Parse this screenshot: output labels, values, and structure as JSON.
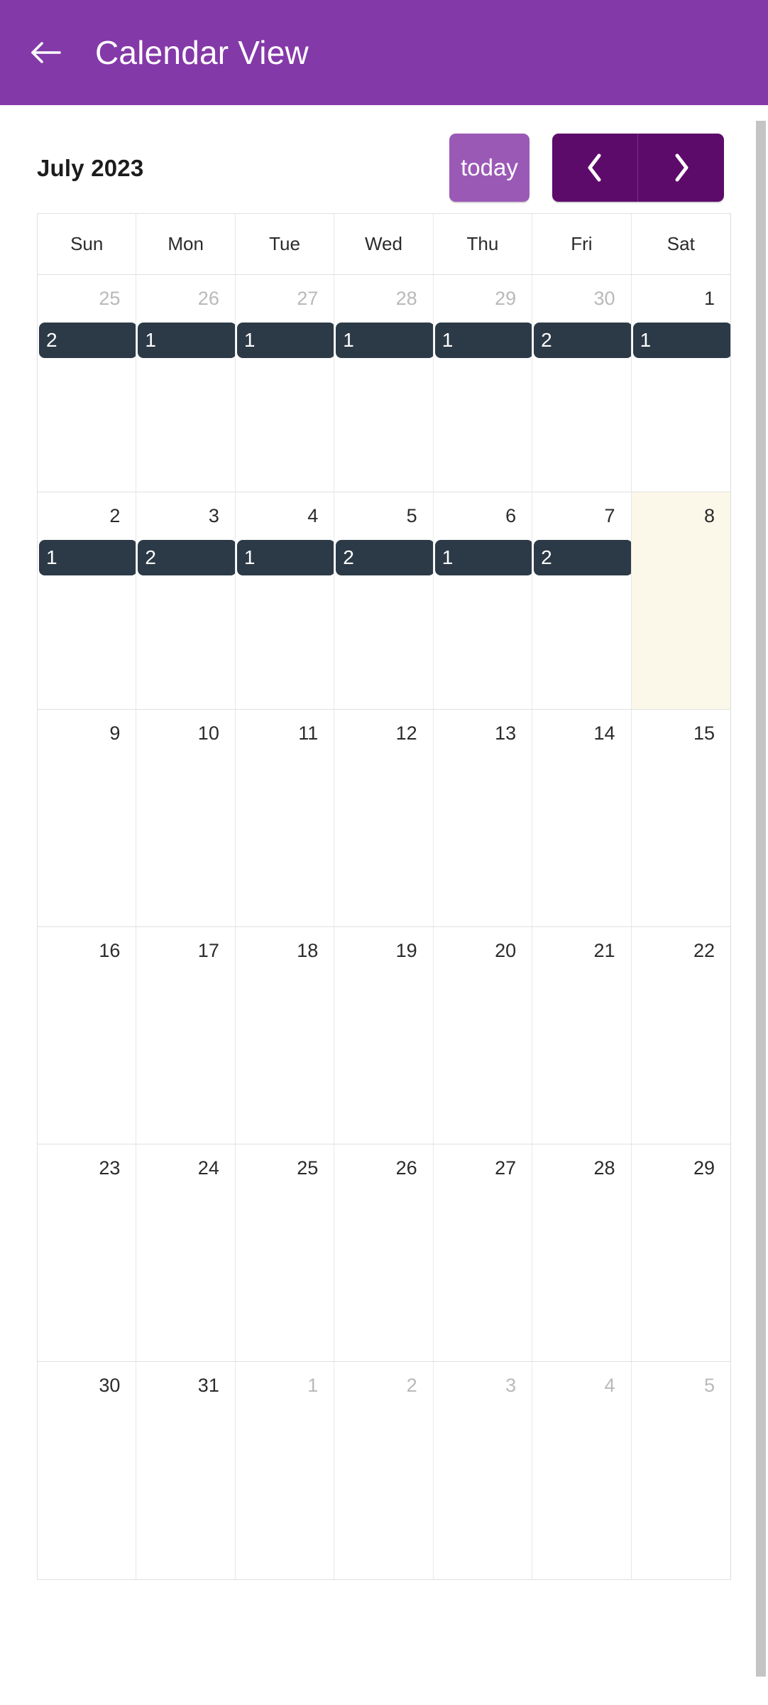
{
  "appbar": {
    "back_icon": "arrow-left-icon",
    "title": "Calendar View",
    "bg_color": "#8439a8"
  },
  "toolbar": {
    "title": "July 2023",
    "today_label": "today",
    "prev_icon": "chevron-left-icon",
    "next_icon": "chevron-right-icon",
    "today_color": "#9b59b6",
    "nav_color": "#5d0b6b"
  },
  "calendar": {
    "weekdays": [
      "Sun",
      "Mon",
      "Tue",
      "Wed",
      "Thu",
      "Fri",
      "Sat"
    ],
    "today_cell_color": "#fcf8e9",
    "event_color": "#2c3a47",
    "weeks": [
      {
        "days": [
          {
            "num": "25",
            "other_month": true,
            "today": false,
            "events": [
              "2"
            ]
          },
          {
            "num": "26",
            "other_month": true,
            "today": false,
            "events": [
              "1"
            ]
          },
          {
            "num": "27",
            "other_month": true,
            "today": false,
            "events": [
              "1"
            ]
          },
          {
            "num": "28",
            "other_month": true,
            "today": false,
            "events": [
              "1"
            ]
          },
          {
            "num": "29",
            "other_month": true,
            "today": false,
            "events": [
              "1"
            ]
          },
          {
            "num": "30",
            "other_month": true,
            "today": false,
            "events": [
              "2"
            ]
          },
          {
            "num": "1",
            "other_month": false,
            "today": false,
            "events": [
              "1"
            ]
          }
        ]
      },
      {
        "days": [
          {
            "num": "2",
            "other_month": false,
            "today": false,
            "events": [
              "1"
            ]
          },
          {
            "num": "3",
            "other_month": false,
            "today": false,
            "events": [
              "2"
            ]
          },
          {
            "num": "4",
            "other_month": false,
            "today": false,
            "events": [
              "1"
            ]
          },
          {
            "num": "5",
            "other_month": false,
            "today": false,
            "events": [
              "2"
            ]
          },
          {
            "num": "6",
            "other_month": false,
            "today": false,
            "events": [
              "1"
            ]
          },
          {
            "num": "7",
            "other_month": false,
            "today": false,
            "events": [
              "2"
            ]
          },
          {
            "num": "8",
            "other_month": false,
            "today": true,
            "events": []
          }
        ]
      },
      {
        "days": [
          {
            "num": "9",
            "other_month": false,
            "today": false,
            "events": []
          },
          {
            "num": "10",
            "other_month": false,
            "today": false,
            "events": []
          },
          {
            "num": "11",
            "other_month": false,
            "today": false,
            "events": []
          },
          {
            "num": "12",
            "other_month": false,
            "today": false,
            "events": []
          },
          {
            "num": "13",
            "other_month": false,
            "today": false,
            "events": []
          },
          {
            "num": "14",
            "other_month": false,
            "today": false,
            "events": []
          },
          {
            "num": "15",
            "other_month": false,
            "today": false,
            "events": []
          }
        ]
      },
      {
        "days": [
          {
            "num": "16",
            "other_month": false,
            "today": false,
            "events": []
          },
          {
            "num": "17",
            "other_month": false,
            "today": false,
            "events": []
          },
          {
            "num": "18",
            "other_month": false,
            "today": false,
            "events": []
          },
          {
            "num": "19",
            "other_month": false,
            "today": false,
            "events": []
          },
          {
            "num": "20",
            "other_month": false,
            "today": false,
            "events": []
          },
          {
            "num": "21",
            "other_month": false,
            "today": false,
            "events": []
          },
          {
            "num": "22",
            "other_month": false,
            "today": false,
            "events": []
          }
        ]
      },
      {
        "days": [
          {
            "num": "23",
            "other_month": false,
            "today": false,
            "events": []
          },
          {
            "num": "24",
            "other_month": false,
            "today": false,
            "events": []
          },
          {
            "num": "25",
            "other_month": false,
            "today": false,
            "events": []
          },
          {
            "num": "26",
            "other_month": false,
            "today": false,
            "events": []
          },
          {
            "num": "27",
            "other_month": false,
            "today": false,
            "events": []
          },
          {
            "num": "28",
            "other_month": false,
            "today": false,
            "events": []
          },
          {
            "num": "29",
            "other_month": false,
            "today": false,
            "events": []
          }
        ]
      },
      {
        "days": [
          {
            "num": "30",
            "other_month": false,
            "today": false,
            "events": []
          },
          {
            "num": "31",
            "other_month": false,
            "today": false,
            "events": []
          },
          {
            "num": "1",
            "other_month": true,
            "today": false,
            "events": []
          },
          {
            "num": "2",
            "other_month": true,
            "today": false,
            "events": []
          },
          {
            "num": "3",
            "other_month": true,
            "today": false,
            "events": []
          },
          {
            "num": "4",
            "other_month": true,
            "today": false,
            "events": []
          },
          {
            "num": "5",
            "other_month": true,
            "today": false,
            "events": []
          }
        ]
      }
    ]
  }
}
